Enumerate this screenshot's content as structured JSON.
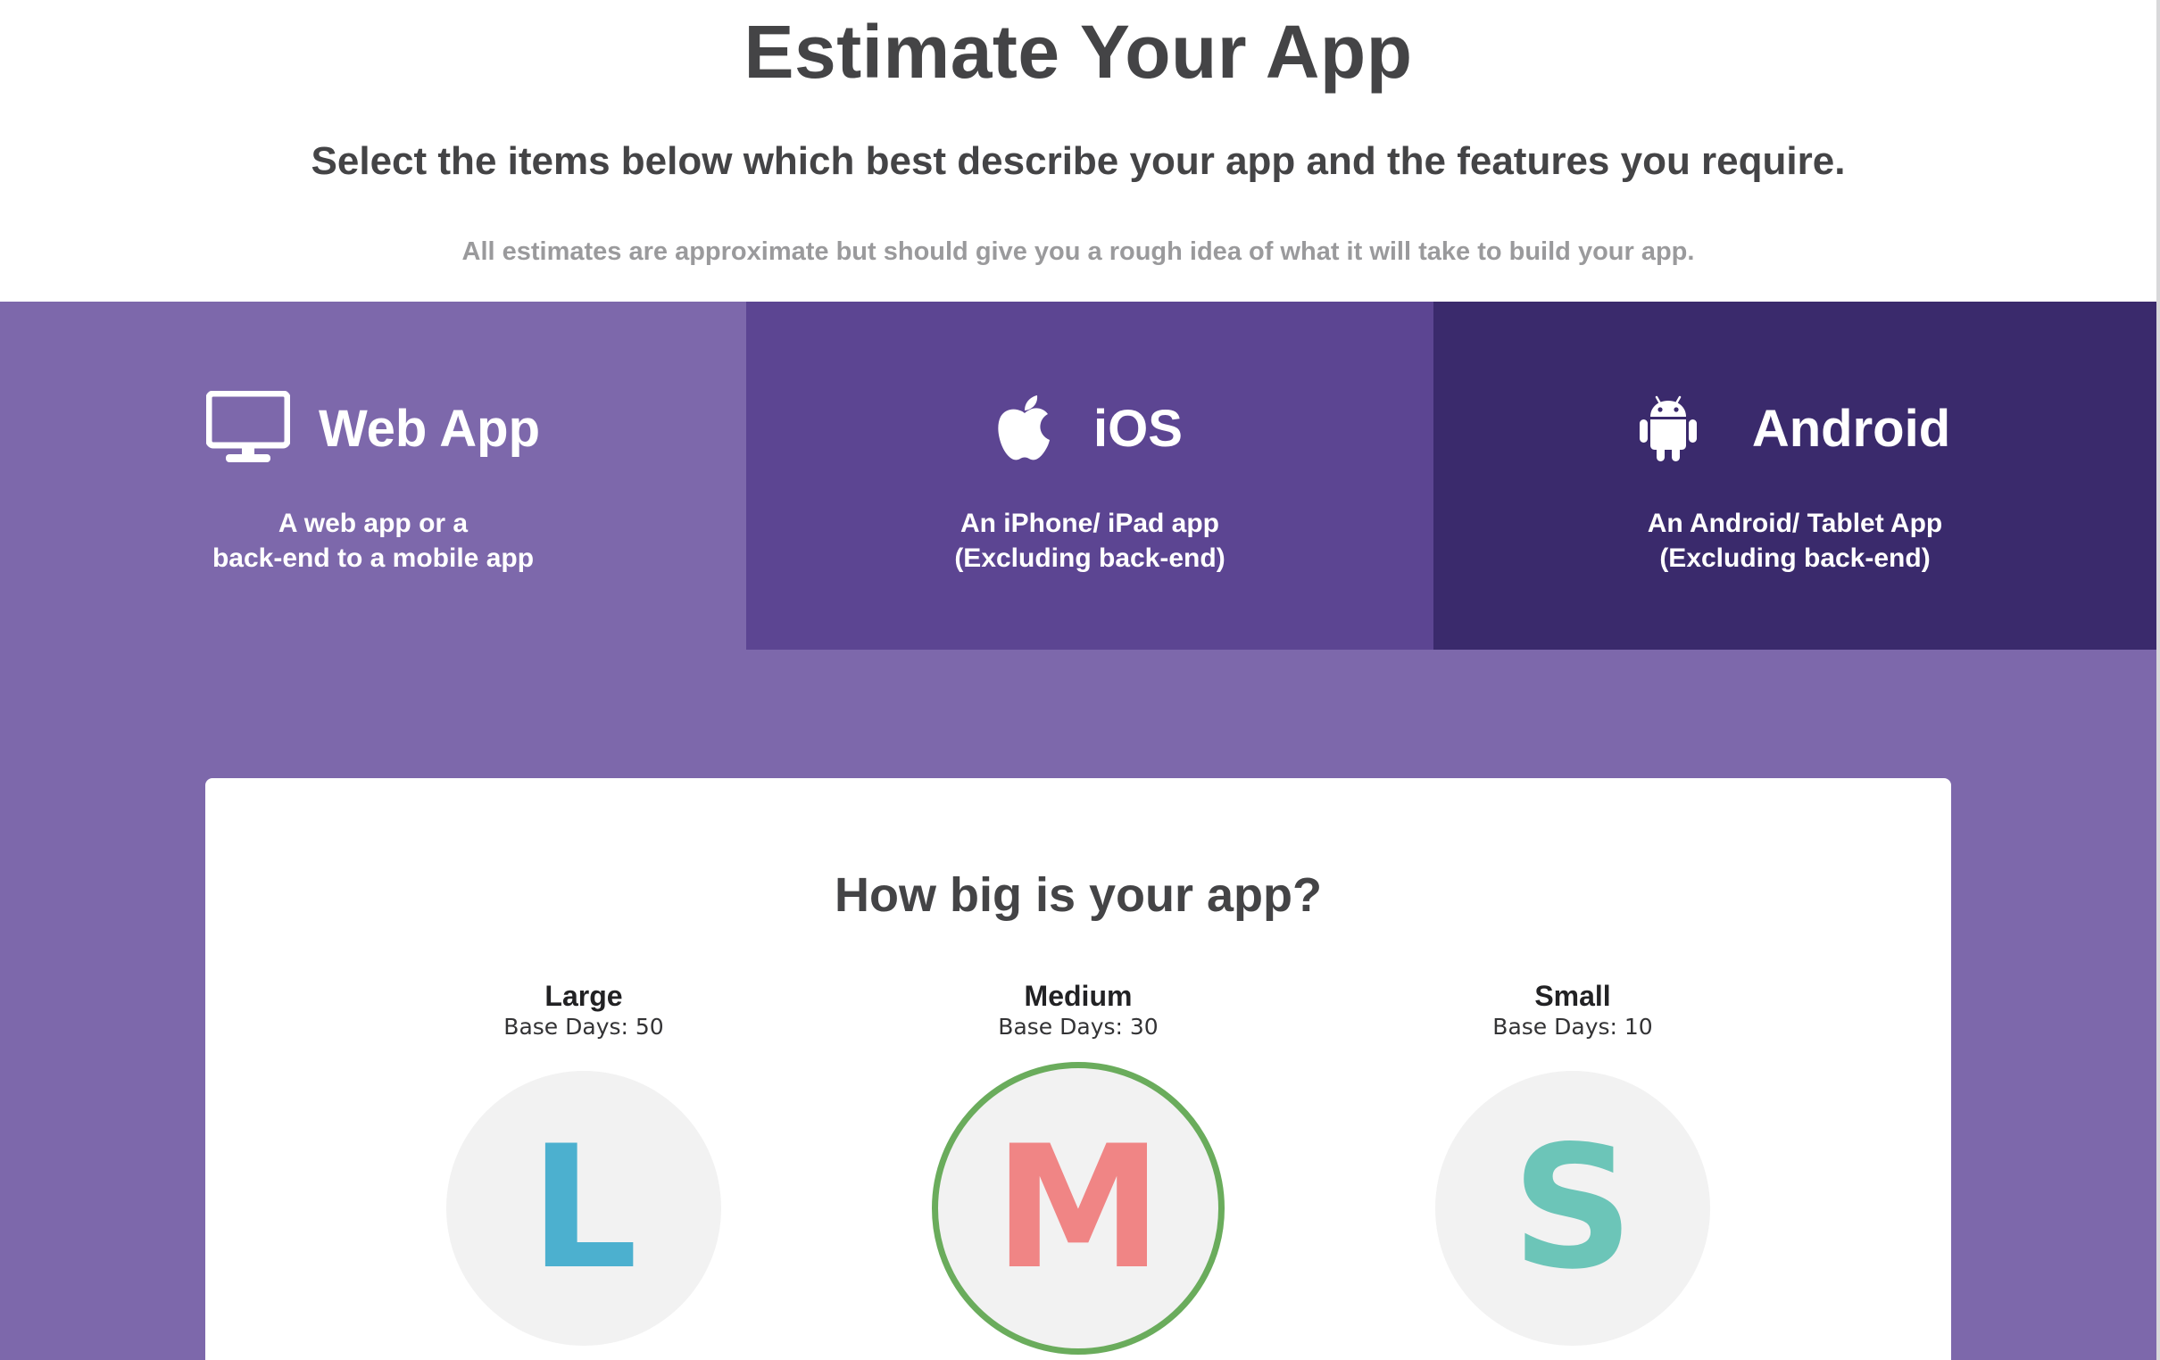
{
  "header": {
    "title": "Estimate Your App",
    "subtitle": "Select the items below which best describe your app and the features you require.",
    "note": "All estimates are approximate but should give you a rough idea of what it will take to build your app."
  },
  "platforms": [
    {
      "name": "Web App",
      "icon": "monitor-icon",
      "desc_line1": "A web app or a",
      "desc_line2": "back-end to a mobile app",
      "bg": "#7d68ab"
    },
    {
      "name": "iOS",
      "icon": "apple-icon",
      "desc_line1": "An iPhone/ iPad app",
      "desc_line2": "(Excluding back-end)",
      "bg": "#5c4592"
    },
    {
      "name": "Android",
      "icon": "android-icon",
      "desc_line1": "An Android/ Tablet App",
      "desc_line2": "(Excluding back-end)",
      "bg": "#3a2a6c"
    }
  ],
  "size_section": {
    "title": "How big is your app?",
    "options": [
      {
        "name": "Large",
        "base_days": "Base Days: 50",
        "letter": "L",
        "color": "#4cb0cf",
        "selected": false
      },
      {
        "name": "Medium",
        "base_days": "Base Days: 30",
        "letter": "M",
        "color": "#f08585",
        "selected": true
      },
      {
        "name": "Small",
        "base_days": "Base Days: 10",
        "letter": "S",
        "color": "#6cc5b8",
        "selected": false
      }
    ],
    "selected_border_color": "#6aac5c"
  },
  "colors": {
    "page_purple": "#7d68ab",
    "text_dark": "#444446",
    "text_muted": "#9a9a9c"
  }
}
